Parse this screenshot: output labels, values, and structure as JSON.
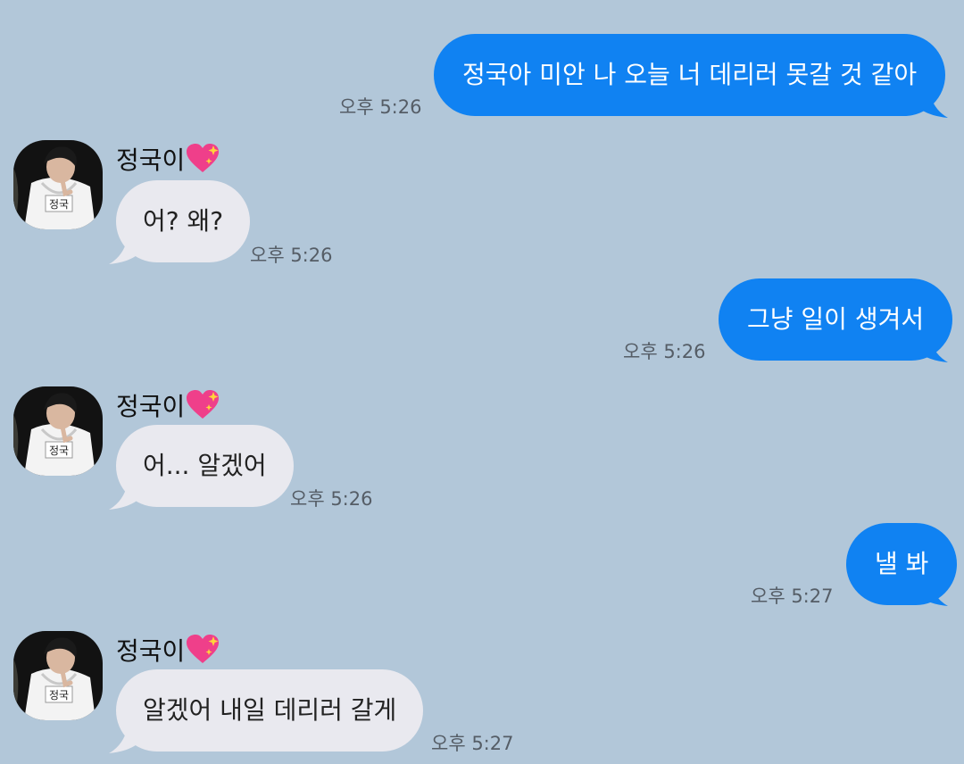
{
  "chat": {
    "sender_name": "정국이",
    "name_emoji": "sparkling-heart-icon",
    "colors": {
      "background": "#b2c7d9",
      "outgoing_bubble": "#1082f2",
      "incoming_bubble": "#e9e9ef"
    },
    "messages": [
      {
        "direction": "outgoing",
        "text": "정국아 미안 나 오늘 너 데리러 못갈 것 같아",
        "time": "오후 5:26"
      },
      {
        "direction": "incoming",
        "text": "어? 왜?",
        "time": "오후 5:26"
      },
      {
        "direction": "outgoing",
        "text": "그냥 일이 생겨서",
        "time": "오후 5:26"
      },
      {
        "direction": "incoming",
        "text": "어... 알겠어",
        "time": "오후 5:26"
      },
      {
        "direction": "outgoing",
        "text": "낼 봐",
        "time": "오후 5:27"
      },
      {
        "direction": "incoming",
        "text": "알겠어 내일 데리러 갈게",
        "time": "오후 5:27"
      }
    ],
    "avatar_label": "정국"
  }
}
